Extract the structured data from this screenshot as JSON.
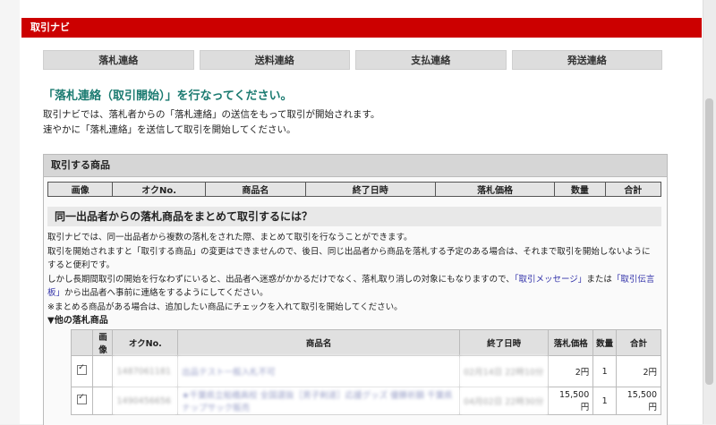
{
  "titlebar": "取引ナビ",
  "steps": [
    "落札連絡",
    "送料連絡",
    "支払連絡",
    "発送連絡"
  ],
  "heading": "「落札連絡（取引開始）」を行なってください。",
  "desc": [
    "取引ナビでは、落札者からの「落札連絡」の送信をもって取引が開始されます。",
    "速やかに「落札連絡」を送信して取引を開始してください。"
  ],
  "panel": {
    "title": "取引する商品",
    "columns": [
      "画像",
      "オクNo.",
      "商品名",
      "終了日時",
      "落札価格",
      "数量",
      "合計"
    ],
    "subhead": "同一出品者からの落札商品をまとめて取引するには？",
    "para1": "取引ナビでは、同一出品者から複数の落札をされた際、まとめて取引を行なうことができます。",
    "para2a": "取引を開始されますと「取引する商品」の変更はできませんので、後日、同じ出品者から商品を落札する予定のある場合は、それまで取引を開始しないように",
    "para2b": "すると便利です。",
    "para3a": "しかし長期間取引の開始を行なわずにいると、出品者へ迷惑がかかるだけでなく、落札取り消しの対象にもなりますので、",
    "link1": "「取引メッセージ」",
    "para3b": "または",
    "link2": "「取引伝言",
    "link2b": "板」",
    "para3c": "から出品者へ事前に連絡をするようにしてください。",
    "note": "※まとめる商品がある場合は、追加したい商品にチェックを入れて取引を開始してください。",
    "others_label": "▼他の落札商品",
    "lot_columns": [
      "画像",
      "オクNo.",
      "商品名",
      "終了日時",
      "落札価格",
      "数量",
      "合計"
    ],
    "rows": [
      {
        "auc": "1487061181",
        "name": "出品テスト一般入札不可",
        "end": "02月14日 22時10分",
        "price": "2円",
        "qty": "1",
        "total": "2円"
      },
      {
        "auc": "1490456656",
        "name": "★千葉県立船橋高校 全国選抜［男子剣道］応援グッズ 優勝祈願 千葉県ナップサック販売",
        "end": "04月02日 22時30分",
        "price": "15,500円",
        "qty": "1",
        "total": "15,500円"
      }
    ]
  }
}
